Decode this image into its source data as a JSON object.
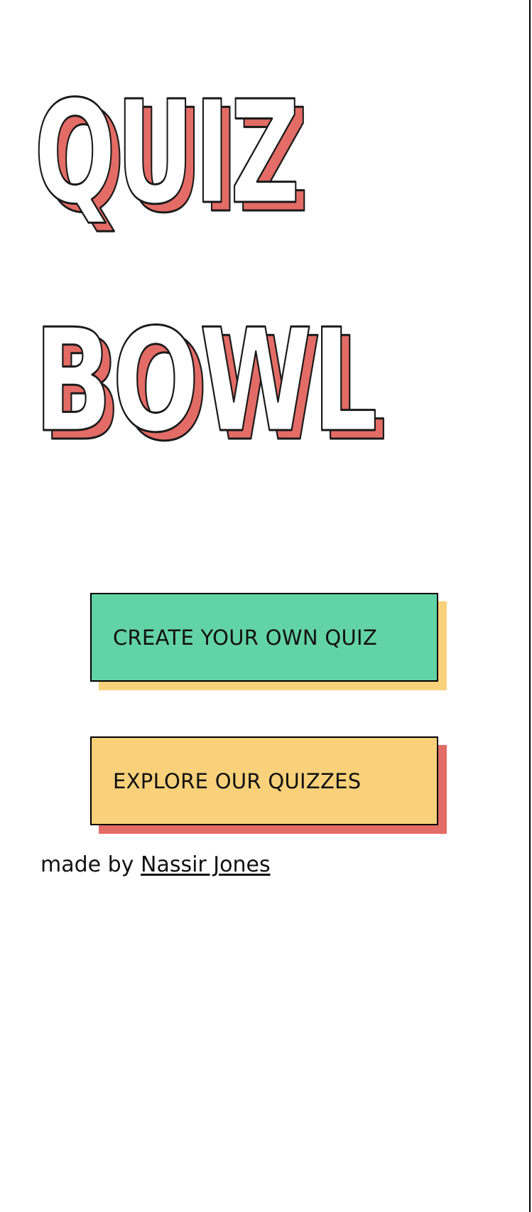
{
  "hero": {
    "title_line1": "QUIZ",
    "title_line2": "BOWL"
  },
  "actions": {
    "create_label": "CREATE YOUR OWN QUIZ",
    "explore_label": "EXPLORE OUR QUIZZES"
  },
  "footer": {
    "made_by_prefix": "made by",
    "author_name": "Nassir Jones"
  },
  "colors": {
    "title_shadow": "#e46c66",
    "title_fill": "#ffffff",
    "title_stroke": "#1a1a1a",
    "create_button": "#62d3a5",
    "explore_button": "#f8d17a",
    "create_shadow": "#f8d17a",
    "explore_shadow": "#e46c66",
    "page_border": "#000000"
  }
}
